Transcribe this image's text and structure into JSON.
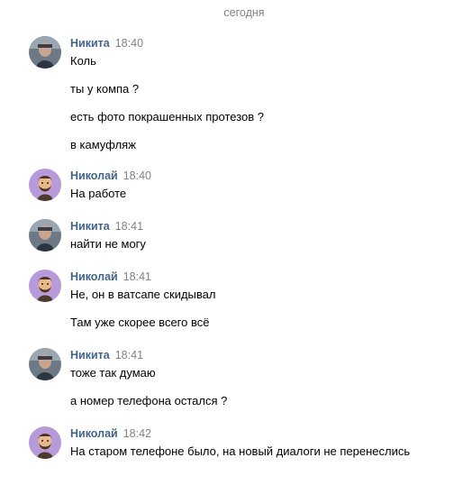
{
  "date_separator": "сегодня",
  "messages": [
    {
      "author": "Никита",
      "time": "18:40",
      "avatar": "photo-avatar",
      "lines": [
        "Коль",
        "ты у компа ?",
        "есть фото покрашенных протезов ?",
        "в камуфляж"
      ]
    },
    {
      "author": "Николай",
      "time": "18:40",
      "avatar": "cartoon-avatar",
      "lines": [
        "На работе"
      ]
    },
    {
      "author": "Никита",
      "time": "18:41",
      "avatar": "photo-avatar",
      "lines": [
        "найти не могу"
      ]
    },
    {
      "author": "Николай",
      "time": "18:41",
      "avatar": "cartoon-avatar",
      "lines": [
        "Не, он в ватсапе скидывал",
        "Там уже скорее всего всё"
      ]
    },
    {
      "author": "Никита",
      "time": "18:41",
      "avatar": "photo-avatar",
      "lines": [
        "тоже так думаю",
        "а номер телефона остался ?"
      ]
    },
    {
      "author": "Николай",
      "time": "18:42",
      "avatar": "cartoon-avatar",
      "lines": [
        "На старом телефоне было, на новый диалоги не перенеслись"
      ]
    }
  ],
  "colors": {
    "author_name": "#42648b",
    "meta_gray": "#828282",
    "cartoon_avatar_bg": "#b79ad9"
  }
}
